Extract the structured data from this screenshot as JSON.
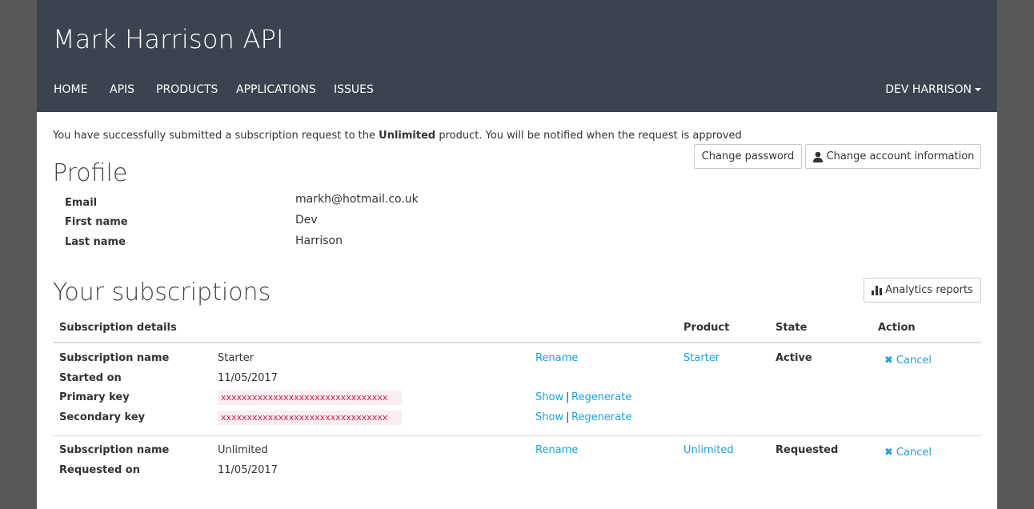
{
  "header": {
    "title": "Mark Harrison API",
    "nav": [
      "HOME",
      "APIS",
      "PRODUCTS",
      "APPLICATIONS",
      "ISSUES"
    ],
    "user": "DEV HARRISON"
  },
  "notice": {
    "before": "You have successfully submitted a subscription request to the ",
    "product": "Unlimited",
    "after": " product. You will be notified when the request is approved"
  },
  "buttons": {
    "change_password": "Change password",
    "change_account": "Change account information",
    "analytics": "Analytics reports"
  },
  "profile": {
    "title": "Profile",
    "fields": [
      {
        "label": "Email",
        "value": "markh@hotmail.co.uk"
      },
      {
        "label": "First name",
        "value": "Dev"
      },
      {
        "label": "Last name",
        "value": "Harrison"
      }
    ]
  },
  "subscriptions": {
    "title": "Your subscriptions",
    "headers": {
      "details": "Subscription details",
      "product": "Product",
      "state": "State",
      "action": "Action"
    },
    "items": [
      {
        "rows": [
          {
            "label": "Subscription name",
            "value": "Starter"
          },
          {
            "label": "Started on",
            "value": "11/05/2017"
          },
          {
            "label": "Primary key",
            "value": "xxxxxxxxxxxxxxxxxxxxxxxxxxxxxxxx"
          },
          {
            "label": "Secondary key",
            "value": "xxxxxxxxxxxxxxxxxxxxxxxxxxxxxxxx"
          }
        ],
        "rename": "Rename",
        "show": "Show",
        "separator": "|",
        "regenerate": "Regenerate",
        "product": "Starter",
        "state": "Active",
        "action": "Cancel"
      },
      {
        "rows": [
          {
            "label": "Subscription name",
            "value": "Unlimited"
          },
          {
            "label": "Requested on",
            "value": "11/05/2017"
          }
        ],
        "rename": "Rename",
        "product": "Unlimited",
        "state": "Requested",
        "action": "Cancel"
      }
    ]
  },
  "colors": {
    "header_bg": "#3c4350",
    "link": "#1ba1e2",
    "key_text": "#c7254e",
    "key_bg": "#fbeef2"
  }
}
